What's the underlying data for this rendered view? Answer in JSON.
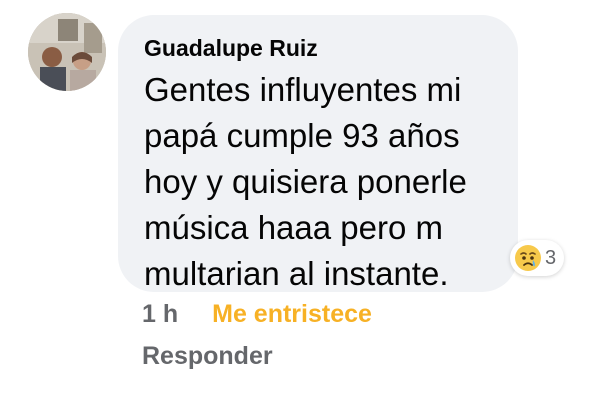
{
  "comment": {
    "author": "Guadalupe Ruiz",
    "text": "Gentes influyentes mi\npapá cumple 93 años\nhoy y quisiera ponerle\nmúsica haaa pero m\nmultarian al instante.",
    "reaction_icon": "sad-emoji-icon",
    "reaction_count": "3"
  },
  "meta": {
    "time": "1 h",
    "my_reaction": "Me entristece",
    "reply": "Responder"
  },
  "colors": {
    "bubble": "#f0f2f5",
    "reaction_accent": "#f7b125",
    "meta_text": "#65676b"
  }
}
